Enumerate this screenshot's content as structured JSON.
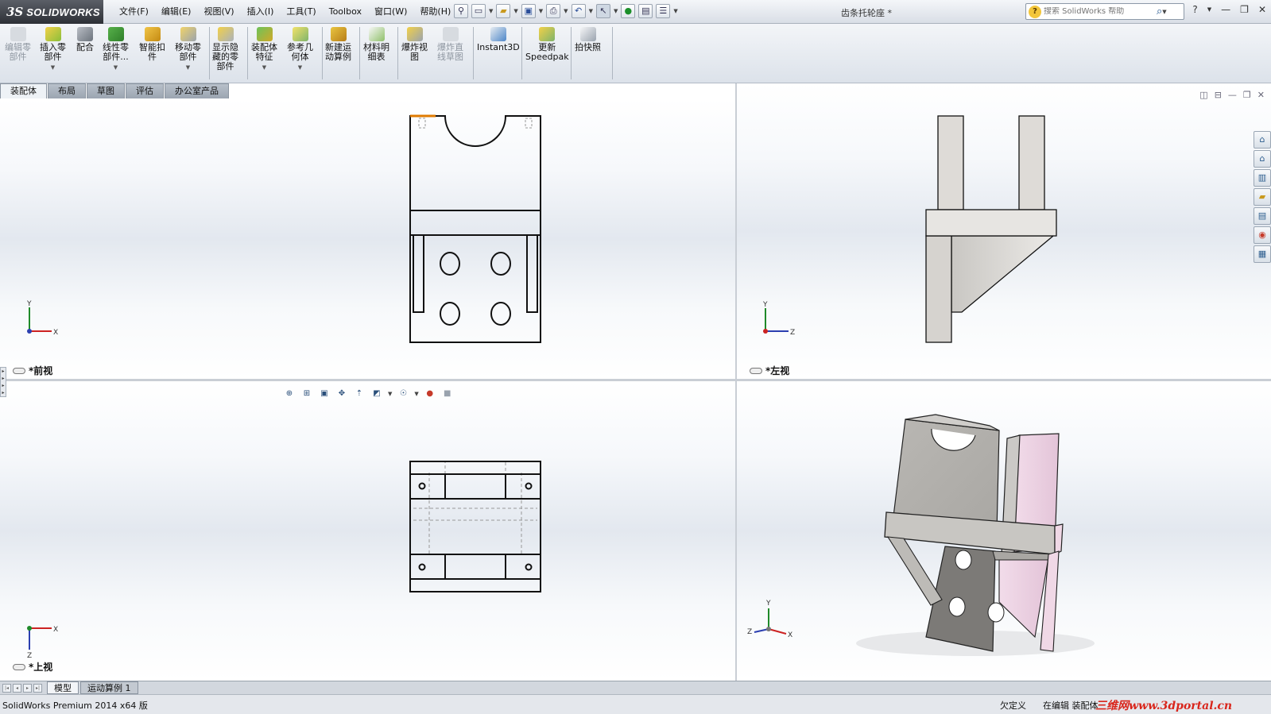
{
  "app": {
    "logo_mark": "3S",
    "logo_name": "SOLIDWORKS",
    "document_title": "齿条托轮座 *"
  },
  "menu": [
    "文件(F)",
    "编辑(E)",
    "视图(V)",
    "插入(I)",
    "工具(T)",
    "Toolbox",
    "窗口(W)",
    "帮助(H)"
  ],
  "search": {
    "placeholder": "搜索 SolidWorks 帮助"
  },
  "toolbar": {
    "edit_component": "编辑零\n部件",
    "insert_component": "插入零\n部件",
    "mate": "配合",
    "linear_pattern": "线性零\n部件...",
    "smart_fasteners": "智能扣\n件",
    "move_component": "移动零\n部件",
    "show_hidden": "显示隐\n藏的零\n部件",
    "assembly_features": "装配体\n特征",
    "reference_geometry": "参考几\n何体",
    "new_motion_study": "新建运\n动算例",
    "bom": "材料明\n细表",
    "exploded_view": "爆炸视\n图",
    "explode_line_sketch": "爆炸直\n线草图",
    "instant3d": "Instant3D",
    "update_speedpak": "更新\nSpeedpak",
    "take_snapshot": "拍快照"
  },
  "tabs": [
    "装配体",
    "布局",
    "草图",
    "评估",
    "办公室产品"
  ],
  "viewports": {
    "front_label": "*前视",
    "left_label": "*左视",
    "top_label": "*上视"
  },
  "axes": {
    "x": "X",
    "y": "Y",
    "z": "Z"
  },
  "bottom_tabs": [
    "模型",
    "运动算例 1"
  ],
  "status": {
    "product": "SolidWorks Premium 2014 x64 版",
    "definition": "欠定义",
    "editing": "在编辑 装配体",
    "watermark": "三维网www.3dportal.cn"
  }
}
